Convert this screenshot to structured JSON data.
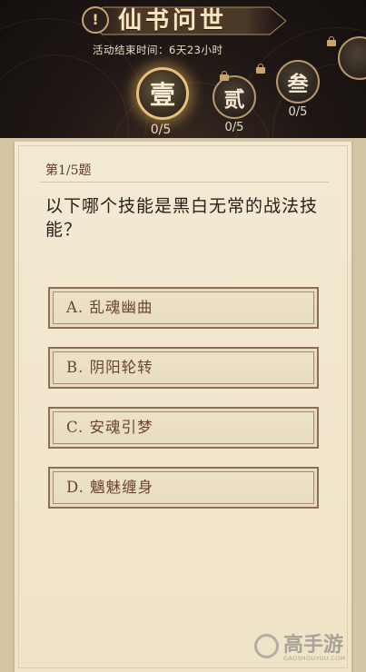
{
  "header": {
    "title": "仙书问世",
    "alert_icon": "!",
    "subtitle": "活动结束时间：6天23小时",
    "stages": [
      {
        "label": "壹",
        "progress": "0/5",
        "active": true,
        "locked": false
      },
      {
        "label": "贰",
        "progress": "0/5",
        "active": false,
        "locked": true
      },
      {
        "label": "叁",
        "progress": "0/5",
        "active": false,
        "locked": true
      }
    ]
  },
  "quiz": {
    "question_number": "第1/5题",
    "question": "以下哪个技能是黑白无常的战法技能？",
    "options": [
      {
        "label": "A. 乱魂幽曲"
      },
      {
        "label": "B. 阴阳轮转"
      },
      {
        "label": "C. 安魂引梦"
      },
      {
        "label": "D. 魑魅缠身"
      }
    ]
  },
  "watermark": {
    "text": "高手游",
    "url": "GAOSHOUYOU.COM"
  },
  "colors": {
    "header_bg": "#1d1614",
    "card_bg": "#f1e6cc",
    "option_border": "#8a6f55",
    "option_text": "#6a4433",
    "gold_glow": "#e8c27a"
  }
}
